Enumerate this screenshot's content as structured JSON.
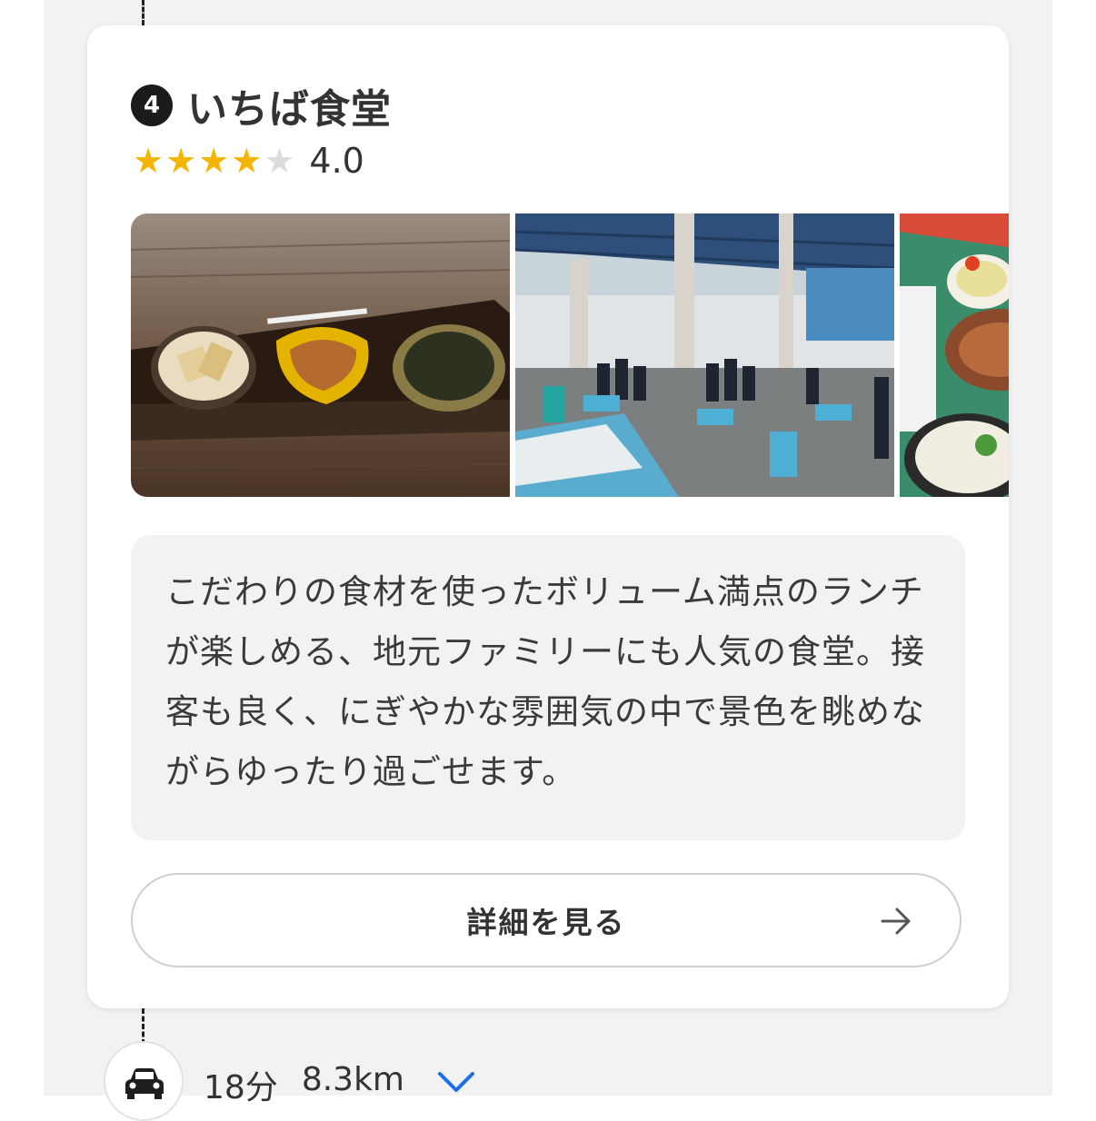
{
  "spot": {
    "number": "4",
    "name": "いちば食堂",
    "rating": 4.0,
    "rating_text": "4.0",
    "stars_total": 5,
    "stars_filled": 4
  },
  "photos": [
    {
      "subject": "small side dishes on wooden table"
    },
    {
      "subject": "fish market under blue roof"
    },
    {
      "subject": "set meal with fish and rice"
    }
  ],
  "description": "こだわりの食材を使ったボリューム満点のランチが楽しめる、地元ファミリーにも人気の食堂。接客も良く、にぎやかな雰囲気の中で景色を眺めながらゆったり過ごせます。",
  "detail_button": {
    "label": "詳細を見る"
  },
  "travel": {
    "time": "18分",
    "distance": "8.3km"
  },
  "colors": {
    "star": "#f5b400",
    "chevron": "#1a6fe8",
    "badge": "#1b1b1b"
  }
}
